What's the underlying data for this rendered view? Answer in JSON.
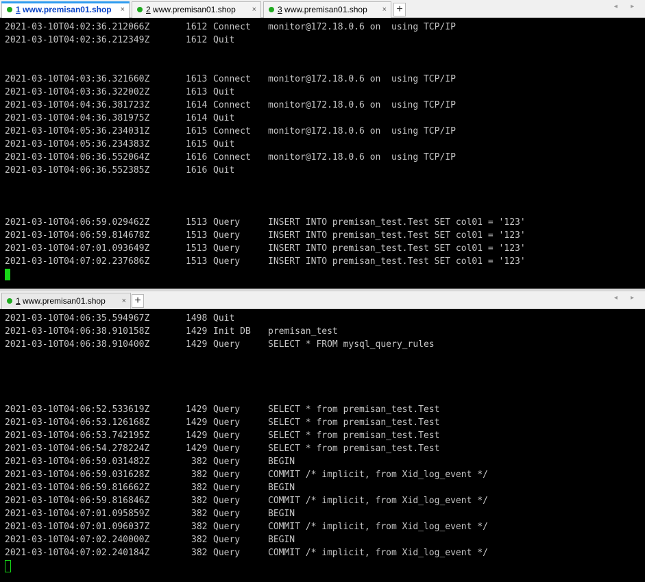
{
  "top_pane": {
    "tabs": [
      {
        "num": "1",
        "title": " www.premisan01.shop",
        "close": "×"
      },
      {
        "num": "2",
        "title": " www.premisan01.shop",
        "close": "×"
      },
      {
        "num": "3",
        "title": " www.premisan01.shop",
        "close": "×"
      }
    ],
    "plus": "+",
    "arrows": "◂ ▸",
    "lines": [
      {
        "ts": "2021-03-10T04:02:36.212066Z",
        "id": "1612",
        "cmd": "Connect",
        "arg": "monitor@172.18.0.6 on  using TCP/IP"
      },
      {
        "ts": "2021-03-10T04:02:36.212349Z",
        "id": "1612",
        "cmd": "Quit",
        "arg": ""
      },
      {
        "ts": "2021-03-10T04:03:36.321660Z",
        "id": "1613",
        "cmd": "Connect",
        "arg": "monitor@172.18.0.6 on  using TCP/IP"
      },
      {
        "ts": "2021-03-10T04:03:36.322002Z",
        "id": "1613",
        "cmd": "Quit",
        "arg": ""
      },
      {
        "ts": "2021-03-10T04:04:36.381723Z",
        "id": "1614",
        "cmd": "Connect",
        "arg": "monitor@172.18.0.6 on  using TCP/IP"
      },
      {
        "ts": "2021-03-10T04:04:36.381975Z",
        "id": "1614",
        "cmd": "Quit",
        "arg": ""
      },
      {
        "ts": "2021-03-10T04:05:36.234031Z",
        "id": "1615",
        "cmd": "Connect",
        "arg": "monitor@172.18.0.6 on  using TCP/IP"
      },
      {
        "ts": "2021-03-10T04:05:36.234383Z",
        "id": "1615",
        "cmd": "Quit",
        "arg": ""
      },
      {
        "ts": "2021-03-10T04:06:36.552064Z",
        "id": "1616",
        "cmd": "Connect",
        "arg": "monitor@172.18.0.6 on  using TCP/IP"
      },
      {
        "ts": "2021-03-10T04:06:36.552385Z",
        "id": "1616",
        "cmd": "Quit",
        "arg": ""
      },
      {
        "ts": "2021-03-10T04:06:59.029462Z",
        "id": "1513",
        "cmd": "Query",
        "arg": "INSERT INTO premisan_test.Test SET col01 = '123'"
      },
      {
        "ts": "2021-03-10T04:06:59.814678Z",
        "id": "1513",
        "cmd": "Query",
        "arg": "INSERT INTO premisan_test.Test SET col01 = '123'"
      },
      {
        "ts": "2021-03-10T04:07:01.093649Z",
        "id": "1513",
        "cmd": "Query",
        "arg": "INSERT INTO premisan_test.Test SET col01 = '123'"
      },
      {
        "ts": "2021-03-10T04:07:02.237686Z",
        "id": "1513",
        "cmd": "Query",
        "arg": "INSERT INTO premisan_test.Test SET col01 = '123'"
      }
    ]
  },
  "bottom_pane": {
    "tabs": [
      {
        "num": "1",
        "title": " www.premisan01.shop",
        "close": "×"
      }
    ],
    "plus": "+",
    "arrows": "◂ ▸",
    "lines": [
      {
        "ts": "2021-03-10T04:06:35.594967Z",
        "id": "1498",
        "cmd": "Quit",
        "arg": ""
      },
      {
        "ts": "2021-03-10T04:06:38.910158Z",
        "id": "1429",
        "cmd": "Init DB",
        "arg": "premisan_test"
      },
      {
        "ts": "2021-03-10T04:06:38.910400Z",
        "id": "1429",
        "cmd": "Query",
        "arg": "SELECT * FROM mysql_query_rules"
      },
      {
        "ts": "2021-03-10T04:06:52.533619Z",
        "id": "1429",
        "cmd": "Query",
        "arg": "SELECT * from premisan_test.Test"
      },
      {
        "ts": "2021-03-10T04:06:53.126168Z",
        "id": "1429",
        "cmd": "Query",
        "arg": "SELECT * from premisan_test.Test"
      },
      {
        "ts": "2021-03-10T04:06:53.742195Z",
        "id": "1429",
        "cmd": "Query",
        "arg": "SELECT * from premisan_test.Test"
      },
      {
        "ts": "2021-03-10T04:06:54.278224Z",
        "id": "1429",
        "cmd": "Query",
        "arg": "SELECT * from premisan_test.Test"
      },
      {
        "ts": "2021-03-10T04:06:59.031482Z",
        "id": "382",
        "cmd": "Query",
        "arg": "BEGIN"
      },
      {
        "ts": "2021-03-10T04:06:59.031628Z",
        "id": "382",
        "cmd": "Query",
        "arg": "COMMIT /* implicit, from Xid_log_event */"
      },
      {
        "ts": "2021-03-10T04:06:59.816662Z",
        "id": "382",
        "cmd": "Query",
        "arg": "BEGIN"
      },
      {
        "ts": "2021-03-10T04:06:59.816846Z",
        "id": "382",
        "cmd": "Query",
        "arg": "COMMIT /* implicit, from Xid_log_event */"
      },
      {
        "ts": "2021-03-10T04:07:01.095859Z",
        "id": "382",
        "cmd": "Query",
        "arg": "BEGIN"
      },
      {
        "ts": "2021-03-10T04:07:01.096037Z",
        "id": "382",
        "cmd": "Query",
        "arg": "COMMIT /* implicit, from Xid_log_event */"
      },
      {
        "ts": "2021-03-10T04:07:02.240000Z",
        "id": "382",
        "cmd": "Query",
        "arg": "BEGIN"
      },
      {
        "ts": "2021-03-10T04:07:02.240184Z",
        "id": "382",
        "cmd": "Query",
        "arg": "COMMIT /* implicit, from Xid_log_event */"
      }
    ]
  },
  "colors": {
    "terminal_bg": "#000000",
    "terminal_text": "#c6c6c6",
    "cursor": "#17d617",
    "tab_accent": "#2e9cf0",
    "status_dot": "#1faa1f"
  }
}
